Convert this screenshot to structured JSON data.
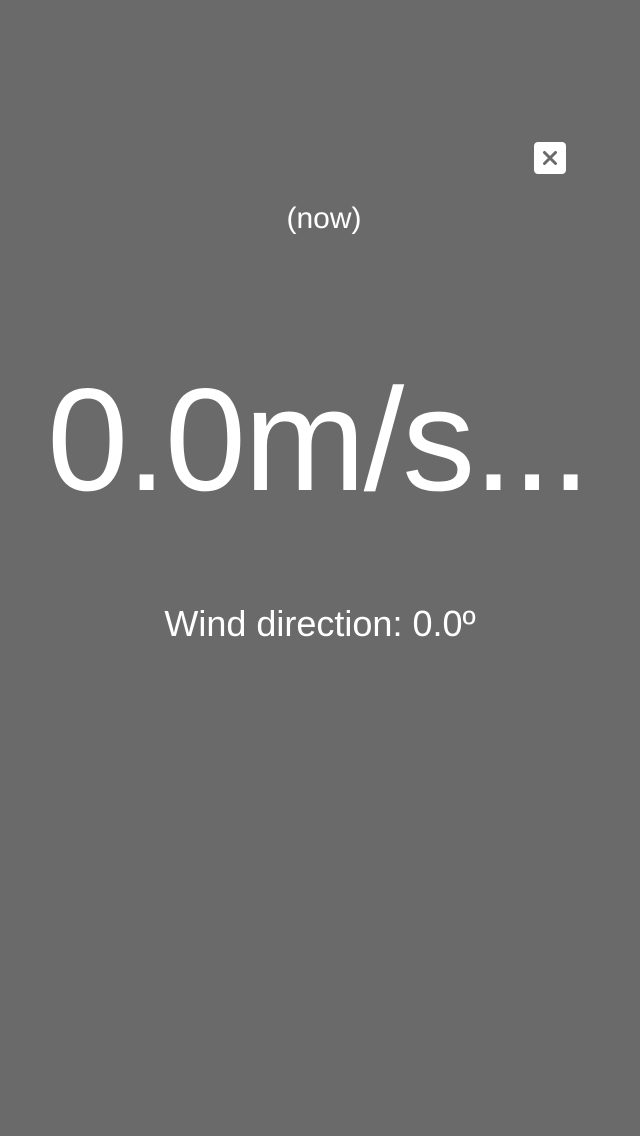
{
  "screen": {
    "background_color": "#6a6a6a",
    "text_color": "#ffffff"
  },
  "close_button": {
    "icon": "close-icon"
  },
  "time_label": "(now)",
  "wind_speed": "0.0m/s...",
  "wind_direction": "Wind direction: 0.0º"
}
